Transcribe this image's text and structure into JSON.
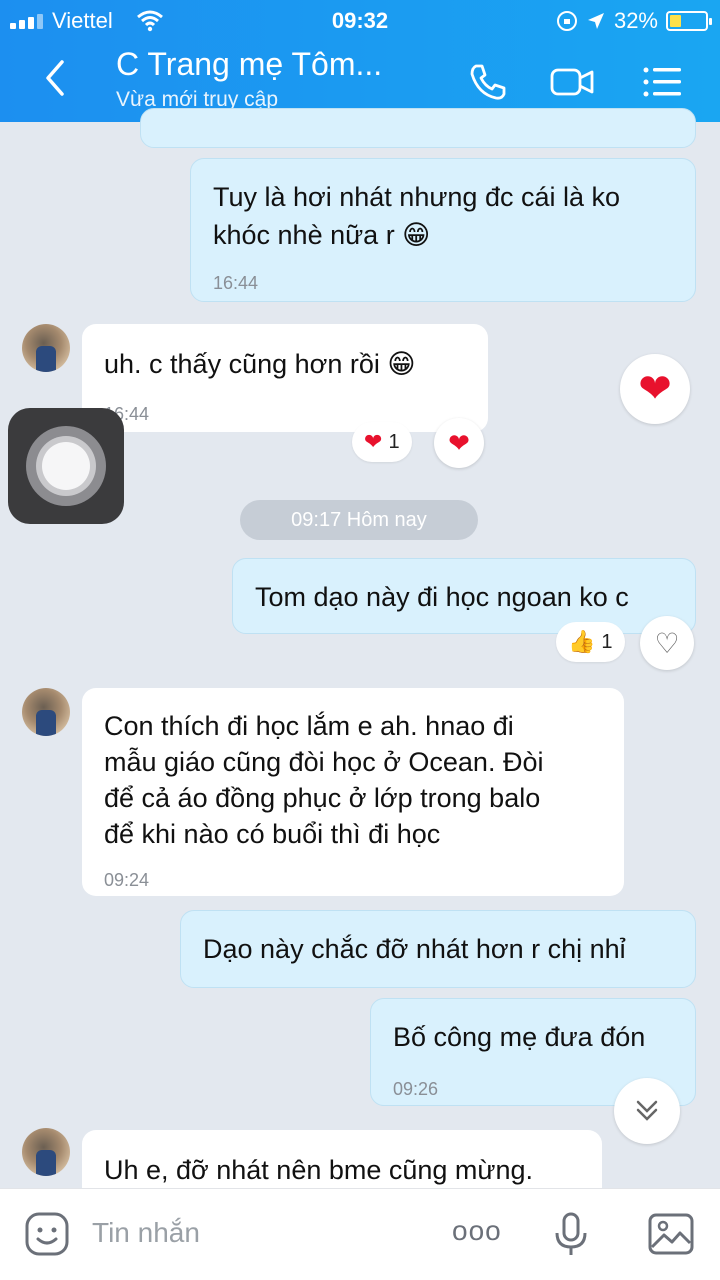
{
  "status_bar": {
    "carrier": "Viettel",
    "time": "09:32",
    "battery": "32%",
    "battery_level": 0.32
  },
  "header": {
    "contact_name": "C Trang mẹ Tôm...",
    "contact_status": "Vừa mới truy cập"
  },
  "messages": [
    {
      "side": "sent",
      "text_line1": "Tuy là hơi nhát nhưng đc cái là ko",
      "text_line2": "khóc nhè nữa r 😁",
      "time": "16:44"
    },
    {
      "side": "received",
      "text": "uh. c thấy cũng hơn rồi 😁",
      "time": "16:44",
      "reaction_count": "1"
    },
    {
      "side": "sent",
      "text": "Tom dạo này đi học ngoan ko c",
      "reaction_count": "1"
    },
    {
      "side": "received",
      "lines": [
        "Con thích đi học lắm e ah. hnao đi",
        "mẫu giáo cũng đòi học ở Ocean. Đòi",
        "để cả áo đồng phục ở lớp trong balo",
        "để khi nào có buổi thì đi học"
      ],
      "time": "09:24"
    },
    {
      "side": "sent",
      "text": "Dạo này chắc đỡ nhát hơn r chị nhỉ"
    },
    {
      "side": "sent",
      "text": "Bố công mẹ đưa đón",
      "time": "09:26"
    },
    {
      "side": "received",
      "text": "Uh e, đỡ nhát nên bme cũng mừng."
    }
  ],
  "date_divider": "09:17 Hôm nay",
  "composer": {
    "placeholder": "Tin nhắn",
    "more": "ooo"
  },
  "colors": {
    "header_blue": "#1c8ff0",
    "sent_bubble": "#d9f1fd",
    "heart_red": "#e8112d"
  },
  "icons": [
    "back-arrow-icon",
    "phone-icon",
    "video-icon",
    "menu-icon",
    "heart-icon",
    "thumbs-up-icon",
    "sticker-icon",
    "microphone-icon",
    "image-icon",
    "scroll-down-icon"
  ]
}
